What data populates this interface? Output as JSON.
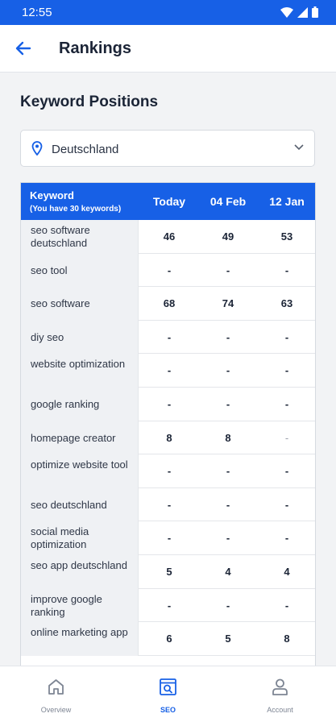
{
  "status_bar": {
    "time": "12:55"
  },
  "app_bar": {
    "title": "Rankings"
  },
  "section": {
    "title": "Keyword Positions"
  },
  "country_select": {
    "value": "Deutschland"
  },
  "table": {
    "header": {
      "keyword": "Keyword",
      "keyword_sub": "(You have 30 keywords)",
      "col_today": "Today",
      "col_2": "04 Feb",
      "col_3": "12 Jan"
    },
    "rows": [
      {
        "keyword": "seo software deutschland",
        "today": "46",
        "c2": "49",
        "c3": "53"
      },
      {
        "keyword": "seo tool",
        "today": "-",
        "c2": "-",
        "c3": "-"
      },
      {
        "keyword": "seo software",
        "today": "68",
        "c2": "74",
        "c3": "63"
      },
      {
        "keyword": "diy seo",
        "today": "-",
        "c2": "-",
        "c3": "-"
      },
      {
        "keyword": "website optimization",
        "today": "-",
        "c2": "-",
        "c3": "-"
      },
      {
        "keyword": "google ranking",
        "today": "-",
        "c2": "-",
        "c3": "-"
      },
      {
        "keyword": "homepage creator",
        "today": "8",
        "c2": "8",
        "c3": "-"
      },
      {
        "keyword": "optimize website tool",
        "today": "-",
        "c2": "-",
        "c3": "-"
      },
      {
        "keyword": "seo deutschland",
        "today": "-",
        "c2": "-",
        "c3": "-"
      },
      {
        "keyword": "social media optimization",
        "today": "-",
        "c2": "-",
        "c3": "-"
      },
      {
        "keyword": "seo app deutschland",
        "today": "5",
        "c2": "4",
        "c3": "4"
      },
      {
        "keyword": "improve google ranking",
        "today": "-",
        "c2": "-",
        "c3": "-"
      },
      {
        "keyword": "online marketing app",
        "today": "6",
        "c2": "5",
        "c3": "8"
      }
    ]
  },
  "bottom_nav": {
    "items": [
      {
        "label": "Overview",
        "icon": "home-icon"
      },
      {
        "label": "SEO",
        "icon": "seo-search-icon"
      },
      {
        "label": "Account",
        "icon": "person-icon"
      }
    ],
    "active": "SEO"
  },
  "colors": {
    "primary": "#1760e6",
    "header_bg": "#1760e6"
  }
}
